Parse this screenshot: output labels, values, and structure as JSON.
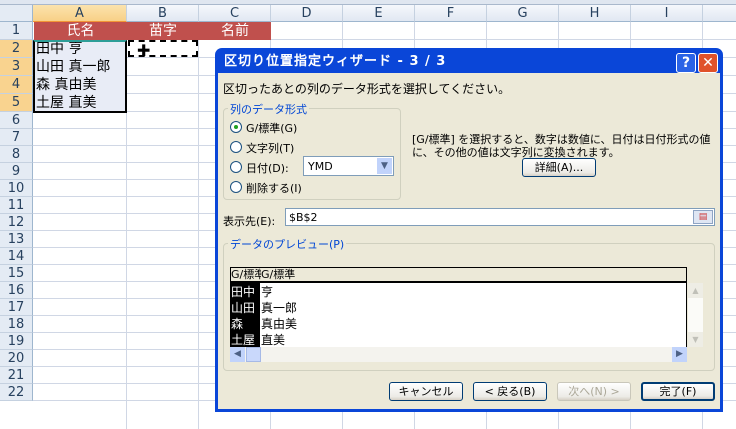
{
  "sheet": {
    "columns": [
      "A",
      "B",
      "C",
      "D",
      "E",
      "F",
      "G",
      "H",
      "I"
    ],
    "rows": [
      "1",
      "2",
      "3",
      "4",
      "5",
      "6",
      "7",
      "8",
      "9",
      "10",
      "11",
      "12",
      "13",
      "14",
      "15",
      "16",
      "17",
      "18",
      "19",
      "20",
      "21",
      "22"
    ],
    "header_cells": [
      "氏名",
      "苗字",
      "名前"
    ],
    "a_cells": [
      "田中 亨",
      "山田 真一郎",
      "森 真由美",
      "土屋 直美"
    ],
    "header_color": "#c0504d"
  },
  "dialog": {
    "title": "区切り位置指定ウィザード - 3 / 3",
    "help_label": "?",
    "close_label": "✕",
    "instruction": "区切ったあとの列のデータ形式を選択してください。",
    "format_group": "列のデータ形式",
    "options": [
      {
        "label": "G/標準(G)",
        "selected": true
      },
      {
        "label": "文字列(T)",
        "selected": false
      },
      {
        "label": "日付(D):",
        "selected": false
      },
      {
        "label": "削除する(I)",
        "selected": false
      }
    ],
    "date_format": "YMD",
    "description": "[G/標準] を選択すると、数字は数値に、日付は日付形式の値に、その他の値は文字列に変換されます。",
    "advanced_label": "詳細(A)...",
    "destination_label": "表示先(E):",
    "destination_value": "$B$2",
    "preview_group": "データのプレビュー(P)",
    "preview_headers": [
      "G/標準",
      "G/標準"
    ],
    "preview_rows": [
      [
        "田中",
        "亨"
      ],
      [
        "山田",
        "真一郎"
      ],
      [
        "森",
        "真由美"
      ],
      [
        "土屋",
        "直美"
      ]
    ],
    "buttons": {
      "cancel": "キャンセル",
      "back": "< 戻る(B)",
      "next": "次へ(N) >",
      "finish": "完了(F)"
    }
  }
}
